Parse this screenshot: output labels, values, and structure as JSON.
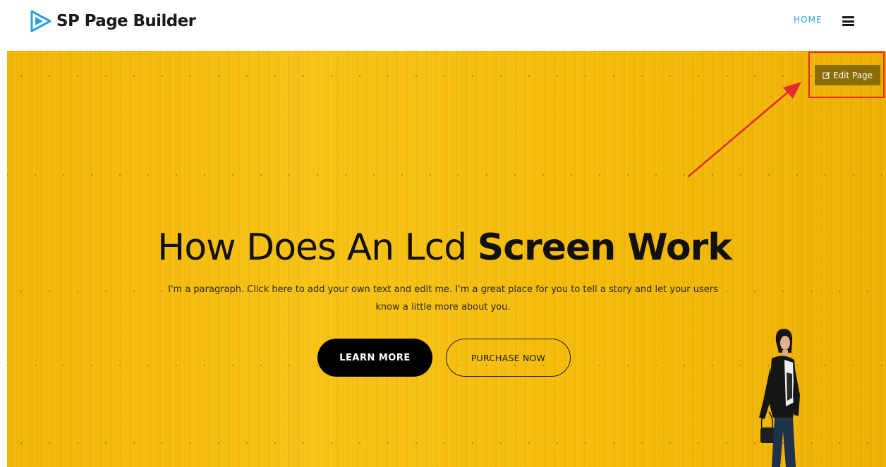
{
  "header": {
    "logo_text": "SP Page Builder",
    "logo_icon": "play-triangle-icon",
    "nav_home": "HOME",
    "menu_icon": "hamburger-menu-icon",
    "accent_color": "#2d9fd9"
  },
  "hero": {
    "background_color": "#f6bd0c",
    "edit_button_label": "Edit Page",
    "edit_icon": "edit-square-icon",
    "title_light": "How Does An Lcd",
    "title_bold": "Screen Work",
    "paragraph": "I'm a paragraph. Click here to add your own text and edit me. I'm a great place for you to tell a story and let your users know a little more about you.",
    "learn_more_label": "LEARN MORE",
    "purchase_label": "PURCHASE NOW",
    "annotation_color": "#e32b2b"
  }
}
